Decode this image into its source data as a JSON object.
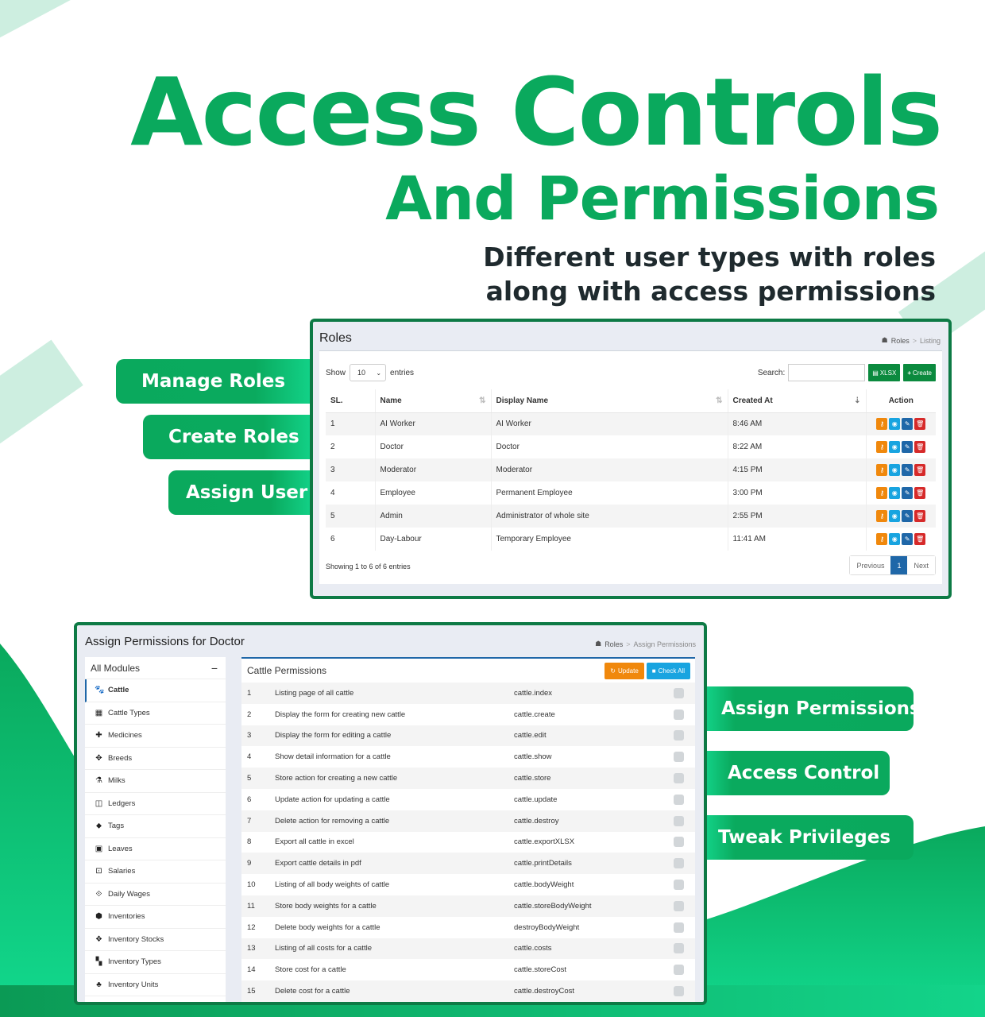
{
  "headline": {
    "title_line1": "Access Controls",
    "title_line2": "And Permissions",
    "subtitle_line1": "Different user types with roles",
    "subtitle_line2": "along with access permissions"
  },
  "features_left": [
    "Manage Roles",
    "Create Roles",
    "Assign User"
  ],
  "features_right": [
    "Assign Permissions",
    "Access Control",
    "Tweak Privileges"
  ],
  "colors": {
    "brand_green": "#0aa95d",
    "window_border": "#0d7a45",
    "btn_orange": "#f0880c",
    "btn_cyan": "#18a4e0",
    "btn_blue": "#1f67a8",
    "btn_red": "#d62a2a"
  },
  "roles_window": {
    "title": "Roles",
    "breadcrumb": [
      "Roles",
      "Listing"
    ],
    "show_label": "Show",
    "entries_value": "10",
    "entries_label": "entries",
    "search_label": "Search:",
    "search_value": "",
    "xlsx_label": "XLSX",
    "create_label": "Create",
    "columns": [
      "SL.",
      "Name",
      "Display Name",
      "Created At",
      "Action"
    ],
    "rows": [
      {
        "sl": "1",
        "name": "AI Worker",
        "display": "AI Worker",
        "created": "8:46 AM"
      },
      {
        "sl": "2",
        "name": "Doctor",
        "display": "Doctor",
        "created": "8:22 AM"
      },
      {
        "sl": "3",
        "name": "Moderator",
        "display": "Moderator",
        "created": "4:15 PM"
      },
      {
        "sl": "4",
        "name": "Employee",
        "display": "Permanent Employee",
        "created": "3:00 PM"
      },
      {
        "sl": "5",
        "name": "Admin",
        "display": "Administrator of whole site",
        "created": "2:55 PM"
      },
      {
        "sl": "6",
        "name": "Day-Labour",
        "display": "Temporary Employee",
        "created": "11:41 AM"
      }
    ],
    "showing_text": "Showing 1 to 6 of 6 entries",
    "pager": {
      "prev": "Previous",
      "current": "1",
      "next": "Next"
    }
  },
  "perm_window": {
    "title": "Assign Permissions for Doctor",
    "breadcrumb": [
      "Roles",
      "Assign Permissions"
    ],
    "modules_title": "All Modules",
    "modules": [
      {
        "label": "Cattle",
        "icon": "paw-icon",
        "glyph": "🐾",
        "active": true
      },
      {
        "label": "Cattle Types",
        "icon": "grid-icon",
        "glyph": "▦"
      },
      {
        "label": "Medicines",
        "icon": "medkit-icon",
        "glyph": "✚"
      },
      {
        "label": "Breeds",
        "icon": "crosshair-icon",
        "glyph": "✥"
      },
      {
        "label": "Milks",
        "icon": "flask-icon",
        "glyph": "⚗"
      },
      {
        "label": "Ledgers",
        "icon": "columns-icon",
        "glyph": "◫"
      },
      {
        "label": "Tags",
        "icon": "tag-icon",
        "glyph": "⬥"
      },
      {
        "label": "Leaves",
        "icon": "calendar-icon",
        "glyph": "▣"
      },
      {
        "label": "Salaries",
        "icon": "money-icon",
        "glyph": "⊡"
      },
      {
        "label": "Daily Wages",
        "icon": "code-icon",
        "glyph": "⟐"
      },
      {
        "label": "Inventories",
        "icon": "cube-icon",
        "glyph": "⬢"
      },
      {
        "label": "Inventory Stocks",
        "icon": "cubes-icon",
        "glyph": "❖"
      },
      {
        "label": "Inventory Types",
        "icon": "th-large-icon",
        "glyph": "▚"
      },
      {
        "label": "Inventory Units",
        "icon": "sitemap-icon",
        "glyph": "♣"
      }
    ],
    "perm_title": "Cattle Permissions",
    "update_label": "Update",
    "check_all_label": "Check All",
    "permissions": [
      {
        "n": "1",
        "desc": "Listing page of all cattle",
        "route": "cattle.index",
        "checked": false
      },
      {
        "n": "2",
        "desc": "Display the form for creating new cattle",
        "route": "cattle.create",
        "checked": false
      },
      {
        "n": "3",
        "desc": "Display the form for editing a cattle",
        "route": "cattle.edit",
        "checked": false
      },
      {
        "n": "4",
        "desc": "Show detail information for a cattle",
        "route": "cattle.show",
        "checked": false
      },
      {
        "n": "5",
        "desc": "Store action for creating a new cattle",
        "route": "cattle.store",
        "checked": false
      },
      {
        "n": "6",
        "desc": "Update action for updating a cattle",
        "route": "cattle.update",
        "checked": false
      },
      {
        "n": "7",
        "desc": "Delete action for removing a cattle",
        "route": "cattle.destroy",
        "checked": false
      },
      {
        "n": "8",
        "desc": "Export all cattle in excel",
        "route": "cattle.exportXLSX",
        "checked": false
      },
      {
        "n": "9",
        "desc": "Export cattle details in pdf",
        "route": "cattle.printDetails",
        "checked": false
      },
      {
        "n": "10",
        "desc": "Listing of all body weights of cattle",
        "route": "cattle.bodyWeight",
        "checked": false
      },
      {
        "n": "11",
        "desc": "Store body weights for a cattle",
        "route": "cattle.storeBodyWeight",
        "checked": false
      },
      {
        "n": "12",
        "desc": "Delete body weights for a cattle",
        "route": "destroyBodyWeight",
        "checked": false
      },
      {
        "n": "13",
        "desc": "Listing of all costs for a cattle",
        "route": "cattle.costs",
        "checked": false
      },
      {
        "n": "14",
        "desc": "Store cost for a cattle",
        "route": "cattle.storeCost",
        "checked": false
      },
      {
        "n": "15",
        "desc": "Delete cost for a cattle",
        "route": "cattle.destroyCost",
        "checked": false
      }
    ]
  }
}
